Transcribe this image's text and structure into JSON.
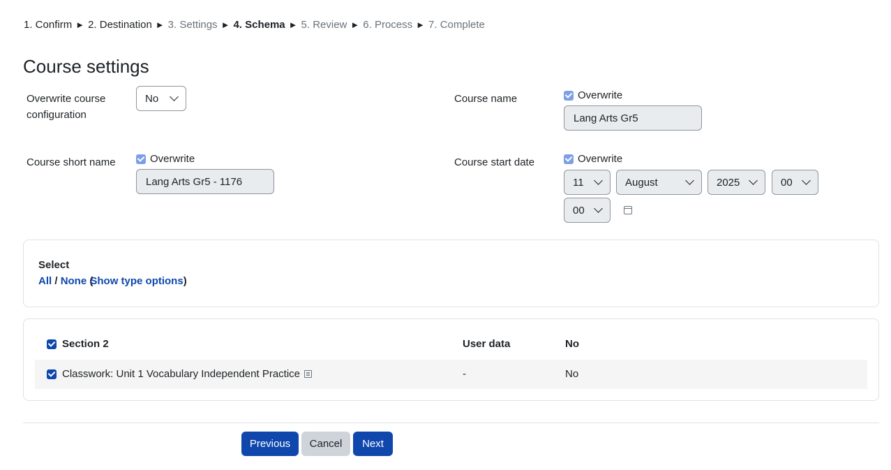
{
  "breadcrumb": {
    "steps": [
      "1. Confirm",
      "2. Destination",
      "3. Settings",
      "4. Schema",
      "5. Review",
      "6. Process",
      "7. Complete"
    ],
    "separator": "►"
  },
  "page_title": "Course settings",
  "overwrite_config": {
    "label": "Overwrite course configuration",
    "value": "No"
  },
  "course_name": {
    "label": "Course name",
    "overwrite_label": "Overwrite",
    "value": "Lang Arts Gr5"
  },
  "short_name": {
    "label": "Course short name",
    "overwrite_label": "Overwrite",
    "value": "Lang Arts Gr5 - 1176"
  },
  "start_date": {
    "label": "Course start date",
    "overwrite_label": "Overwrite",
    "day": "11",
    "month": "August",
    "year": "2025",
    "hour": "00",
    "minute": "00"
  },
  "select_box": {
    "heading": "Select",
    "all": "All",
    "slash": "/",
    "none": "None",
    "open_paren": "(",
    "show_type_options": "Show type options",
    "close_paren": ")"
  },
  "table": {
    "section_label": "Section 2",
    "col_user_data": "User data",
    "col_value": "No",
    "rows": [
      {
        "label": "Classwork: Unit 1 Vocabulary Independent Practice",
        "user_data": "-",
        "value": "No"
      }
    ]
  },
  "buttons": {
    "previous": "Previous",
    "cancel": "Cancel",
    "next": "Next"
  },
  "colors": {
    "primary": "#0f47ad",
    "checkbox_disabled": "#7d9fe6",
    "secondary_button": "#ced4da"
  }
}
